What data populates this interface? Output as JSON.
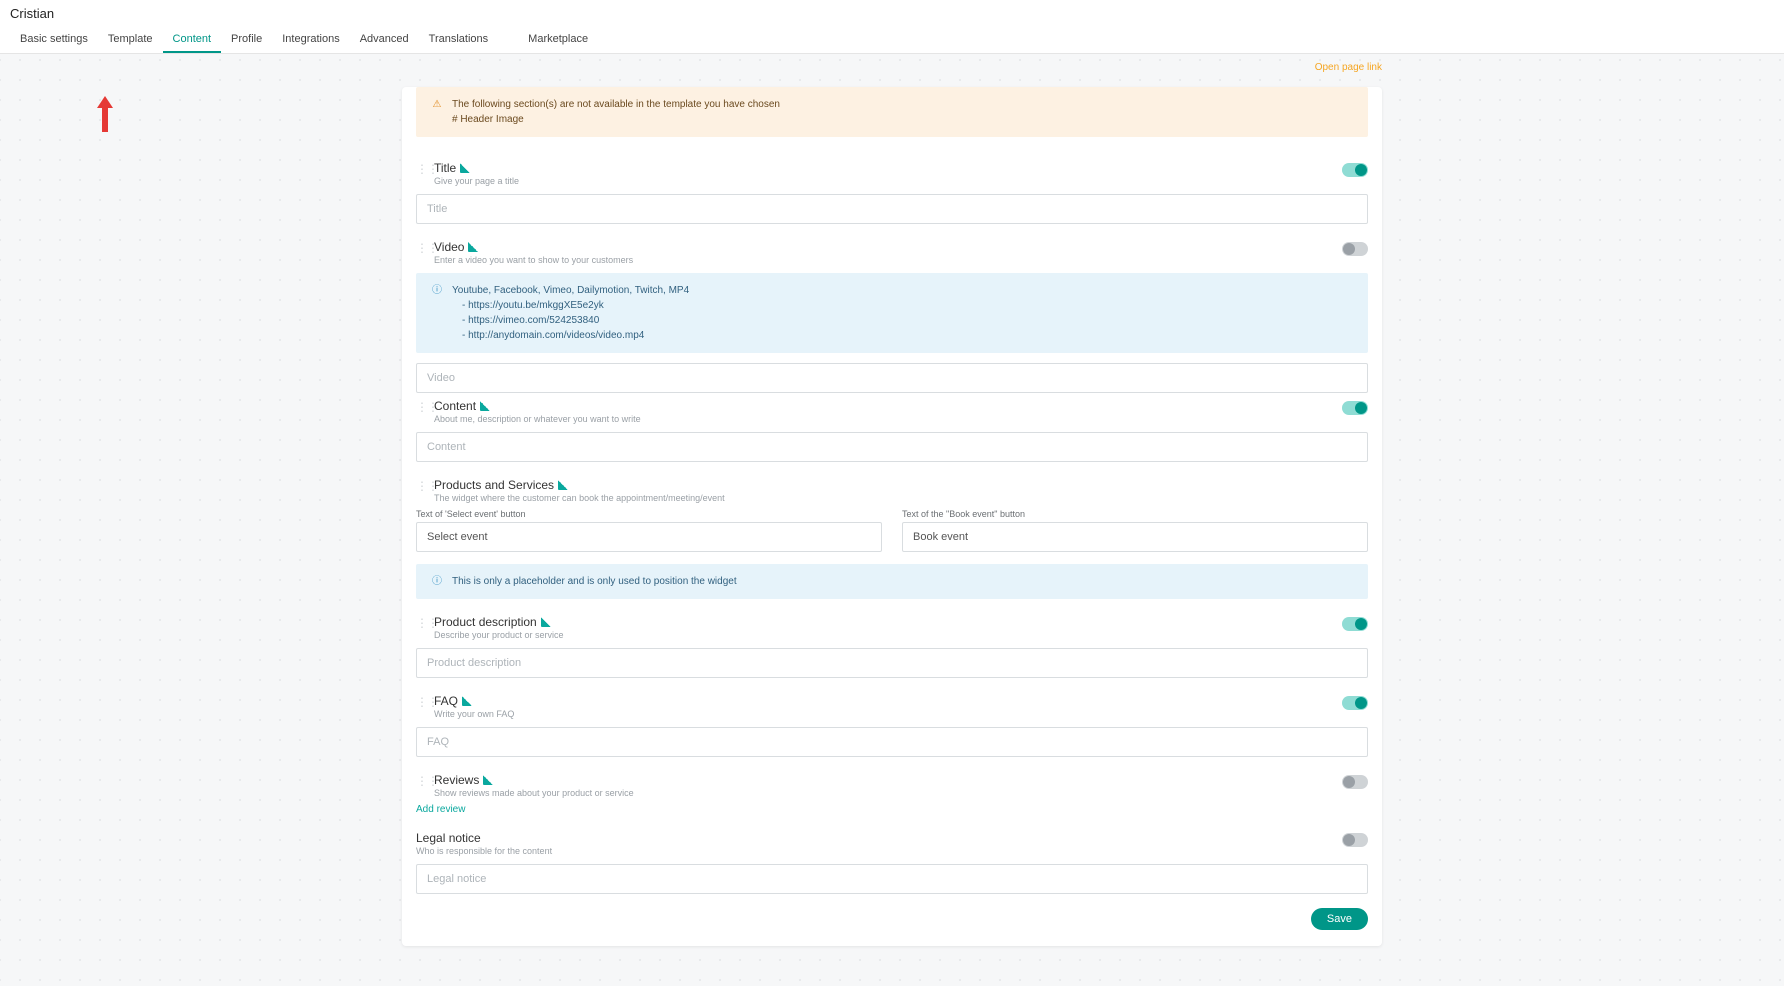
{
  "page_title": "Cristian",
  "tabs": [
    {
      "label": "Basic settings",
      "active": false
    },
    {
      "label": "Template",
      "active": false
    },
    {
      "label": "Content",
      "active": true
    },
    {
      "label": "Profile",
      "active": false
    },
    {
      "label": "Integrations",
      "active": false
    },
    {
      "label": "Advanced",
      "active": false
    },
    {
      "label": "Translations",
      "active": false
    },
    {
      "label": "Marketplace",
      "active": false
    }
  ],
  "open_page_link": "Open page link",
  "warning": {
    "line1": "The following section(s) are not available in the template you have chosen",
    "line2": "# Header Image"
  },
  "sections": {
    "title": {
      "heading": "Title",
      "sub": "Give your page a title",
      "placeholder": "Title",
      "toggle": true
    },
    "video": {
      "heading": "Video",
      "sub": "Enter a video you want to show to your customers",
      "placeholder": "Video",
      "toggle": false,
      "info_head": "Youtube, Facebook, Vimeo, Dailymotion, Twitch, MP4",
      "info_items": [
        "https://youtu.be/mkggXE5e2yk",
        "https://vimeo.com/524253840",
        "http://anydomain.com/videos/video.mp4"
      ]
    },
    "content": {
      "heading": "Content",
      "sub": "About me, description or whatever you want to write",
      "placeholder": "Content",
      "toggle": true
    },
    "products": {
      "heading": "Products and Services",
      "sub": "The widget where the customer can book the appointment/meeting/event",
      "left_label": "Text of 'Select event' button",
      "left_value": "Select event",
      "right_label": "Text of the \"Book event\" button",
      "right_value": "Book event",
      "info_text": "This is only a placeholder and is only used to position the widget"
    },
    "product_desc": {
      "heading": "Product description",
      "sub": "Describe your product or service",
      "placeholder": "Product description",
      "toggle": true
    },
    "faq": {
      "heading": "FAQ",
      "sub": "Write your own FAQ",
      "placeholder": "FAQ",
      "toggle": true
    },
    "reviews": {
      "heading": "Reviews",
      "sub": "Show reviews made about your product or service",
      "add_label": "Add review",
      "toggle": false
    },
    "legal": {
      "heading": "Legal notice",
      "sub": "Who is responsible for the content",
      "placeholder": "Legal notice",
      "toggle": false
    }
  },
  "save_label": "Save"
}
